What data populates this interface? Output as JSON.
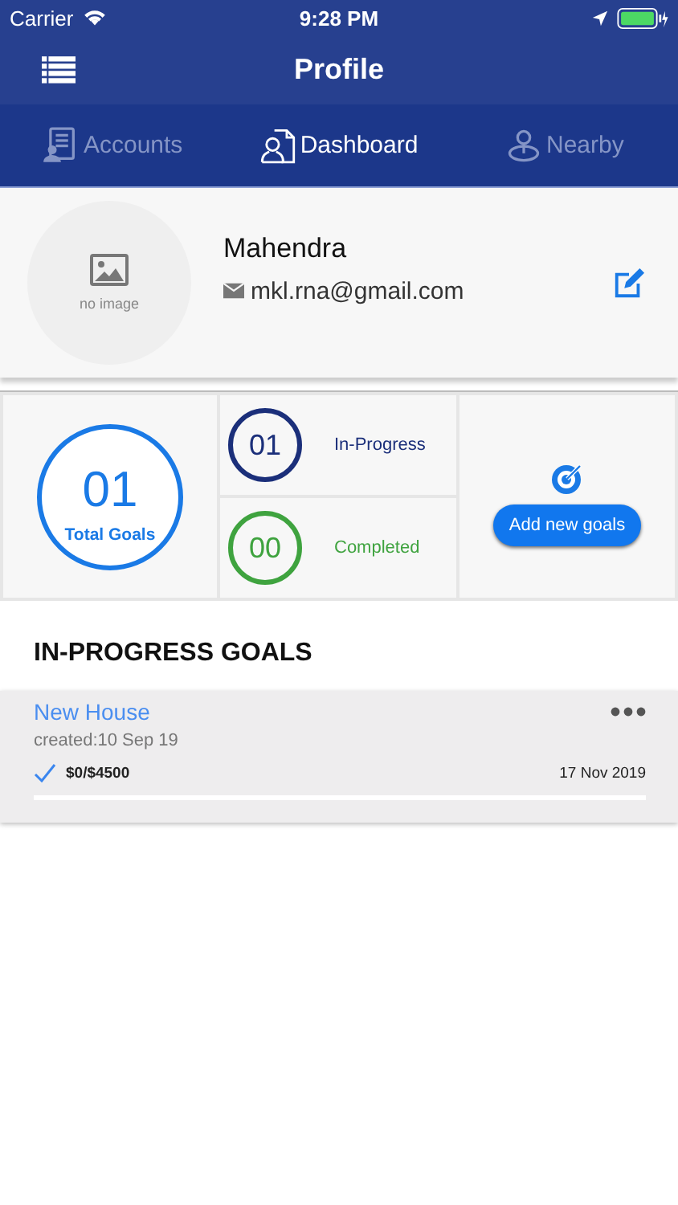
{
  "status_bar": {
    "carrier": "Carrier",
    "time": "9:28 PM"
  },
  "nav_bar": {
    "title": "Profile"
  },
  "tabs": [
    {
      "label": "Accounts",
      "selected": false,
      "kind": "accounts"
    },
    {
      "label": "Dashboard",
      "selected": true,
      "kind": "dashboard"
    },
    {
      "label": "Nearby",
      "selected": false,
      "kind": "nearby"
    }
  ],
  "profile": {
    "avatar_caption": "no image",
    "name": "Mahendra",
    "email": "mkl.rna@gmail.com"
  },
  "total": {
    "count": "01",
    "label": "Total Goals"
  },
  "stats": [
    {
      "count": "01",
      "label": "In-Progress",
      "color": "#1b2f7a"
    },
    {
      "count": "00",
      "label": "Completed",
      "color": "#3fa33f"
    }
  ],
  "add_button": "Add new goals",
  "section_title": "IN-PROGRESS GOALS",
  "goals": [
    {
      "title": "New House",
      "created": "created:10 Sep 19",
      "amount": "$0/$4500",
      "due": "17 Nov 2019",
      "level": 0
    }
  ]
}
